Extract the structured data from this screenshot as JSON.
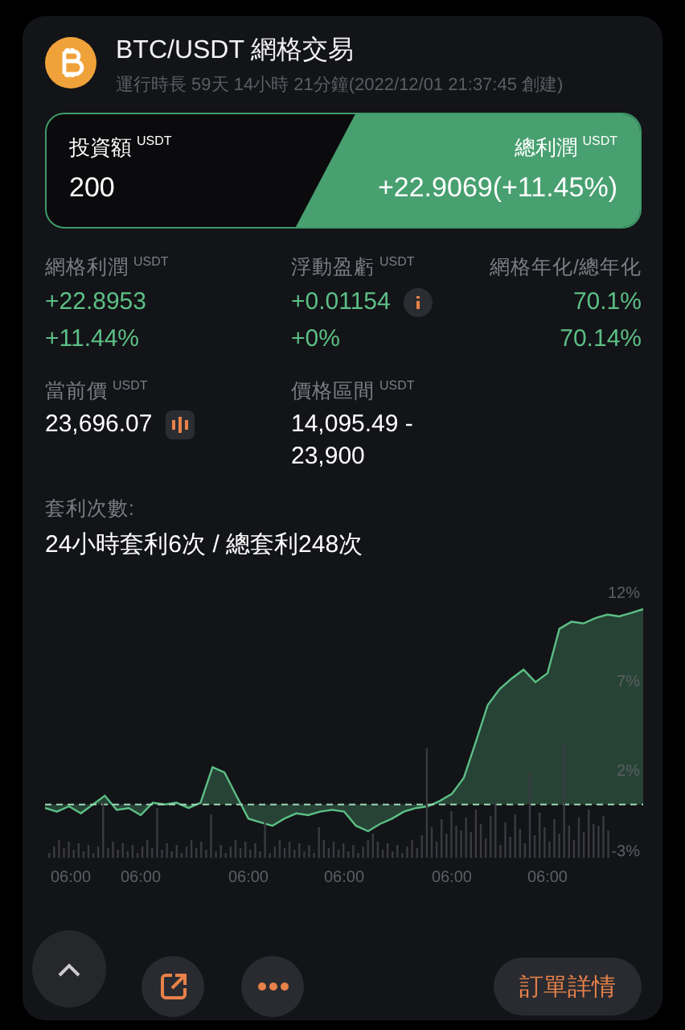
{
  "header": {
    "title": "BTC/USDT 網格交易",
    "subtitle": "運行時長 59天 14小時 21分鐘(2022/12/01 21:37:45 創建)"
  },
  "summary": {
    "investment_label": "投資額",
    "investment_unit": "USDT",
    "investment": "200",
    "profit_label": "總利潤",
    "profit_unit": "USDT",
    "profit": "+22.9069(+11.45%)"
  },
  "stats": [
    {
      "label": "網格利潤",
      "unit": "USDT",
      "values": [
        "+22.8953",
        "+11.44%"
      ],
      "kind": "plain"
    },
    {
      "label": "浮動盈虧",
      "unit": "USDT",
      "values": [
        "+0.01154",
        "+0%"
      ],
      "kind": "info"
    },
    {
      "label": "網格年化/總年化",
      "values": [
        "70.1%",
        "70.14%"
      ],
      "kind": "annualized"
    }
  ],
  "price": {
    "label": "當前價",
    "unit": "USDT",
    "value": "23,696.07"
  },
  "range": {
    "label": "價格區間",
    "unit": "USDT",
    "value": "14,095.49 -\n23,900"
  },
  "arbitrage": {
    "label": "套利次數:",
    "value": "24小時套利6次 / 總套利248次"
  },
  "chart_data": {
    "type": "area",
    "categories": [
      null,
      null,
      "06:00",
      null,
      null,
      null,
      null,
      null,
      "06:00",
      null,
      null,
      null,
      null,
      null,
      null,
      null,
      null,
      "06:00",
      null,
      null,
      null,
      null,
      null,
      null,
      null,
      "06:00",
      null,
      null,
      null,
      null,
      null,
      null,
      null,
      null,
      "06:00",
      null,
      null,
      null,
      null,
      null,
      null,
      null,
      "06:00",
      null,
      null,
      null,
      null,
      null,
      null,
      null,
      null
    ],
    "series": [
      {
        "color": "#5cbf85",
        "values": [
          -0.2,
          -0.4,
          -0.1,
          -0.5,
          0.0,
          0.5,
          -0.3,
          -0.2,
          -0.6,
          0.1,
          0.0,
          0.1,
          -0.2,
          0.1,
          2.1,
          1.8,
          0.5,
          -0.8,
          -1.0,
          -1.2,
          -0.8,
          -0.5,
          -0.6,
          -0.4,
          -0.3,
          -0.4,
          -1.2,
          -1.5,
          -1.1,
          -0.8,
          -0.4,
          -0.2,
          -0.1,
          0.2,
          0.6,
          1.5,
          3.5,
          5.6,
          6.5,
          7.1,
          7.6,
          6.9,
          7.4,
          9.9,
          10.3,
          10.2,
          10.5,
          10.7,
          10.6,
          10.8,
          11.0
        ]
      }
    ],
    "ylim": [
      -3,
      12.5
    ],
    "ref_lines": [
      {
        "axis": "y",
        "value": 0
      }
    ],
    "yticks": [
      {
        "value": 12,
        "label": "12%"
      },
      {
        "value": 7,
        "label": "7%"
      },
      {
        "value": 2,
        "label": "2%"
      },
      {
        "value": -3,
        "label": "-3%"
      }
    ]
  },
  "actions": {
    "details": "訂單詳情"
  }
}
